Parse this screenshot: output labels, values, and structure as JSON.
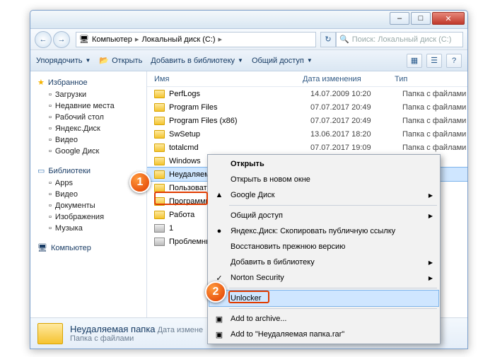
{
  "window_buttons": {
    "min": "–",
    "max": "□",
    "close": "✕"
  },
  "nav": {
    "back": "←",
    "fwd": "→"
  },
  "breadcrumb": {
    "root": "Компьютер",
    "drive": "Локальный диск (C:)"
  },
  "search": {
    "placeholder": "Поиск: Локальный диск (C:)"
  },
  "toolbar": {
    "organize": "Упорядочить",
    "open": "Открыть",
    "addlib": "Добавить в библиотеку",
    "share": "Общий доступ"
  },
  "sidebar": {
    "fav_head": "Избранное",
    "fav": [
      "Загрузки",
      "Недавние места",
      "Рабочий стол",
      "Яндекс.Диск",
      "Видео",
      "Google Диск"
    ],
    "lib_head": "Библиотеки",
    "lib": [
      "Apps",
      "Видео",
      "Документы",
      "Изображения",
      "Музыка"
    ],
    "comp_head": "Компьютер"
  },
  "cols": {
    "name": "Имя",
    "date": "Дата изменения",
    "type": "Тип"
  },
  "rows": [
    {
      "name": "PerfLogs",
      "date": "14.07.2009 10:20",
      "type": "Папка с файлами",
      "k": "folder"
    },
    {
      "name": "Program Files",
      "date": "07.07.2017 20:49",
      "type": "Папка с файлами",
      "k": "folder"
    },
    {
      "name": "Program Files (x86)",
      "date": "07.07.2017 20:49",
      "type": "Папка с файлами",
      "k": "folder"
    },
    {
      "name": "SwSetup",
      "date": "13.06.2017 18:20",
      "type": "Папка с файлами",
      "k": "folder"
    },
    {
      "name": "totalcmd",
      "date": "07.07.2017 19:09",
      "type": "Папка с файлами",
      "k": "folder"
    },
    {
      "name": "Windows",
      "date": "",
      "type": "лами",
      "k": "folder"
    },
    {
      "name": "Неудаляема",
      "date": "",
      "type": "лами",
      "k": "folder",
      "sel": true
    },
    {
      "name": "Пользовател",
      "date": "",
      "type": "лами",
      "k": "folder"
    },
    {
      "name": "Программы",
      "date": "",
      "type": "лами",
      "k": "folder"
    },
    {
      "name": "Работа",
      "date": "",
      "type": "лами",
      "k": "folder"
    },
    {
      "name": "1",
      "date": "",
      "type": "hive",
      "k": "zip"
    },
    {
      "name": "Проблемный",
      "date": "",
      "type": "hive",
      "k": "zip"
    }
  ],
  "ctx": {
    "items": [
      {
        "t": "Открыть",
        "bold": true
      },
      {
        "t": "Открыть в новом окне"
      },
      {
        "t": "Google Диск",
        "arrow": true,
        "ico": "▲"
      },
      {
        "sep": true
      },
      {
        "t": "Общий доступ",
        "arrow": true
      },
      {
        "t": "Яндекс.Диск: Скопировать публичную ссылку",
        "ico": "●"
      },
      {
        "t": "Восстановить прежнюю версию"
      },
      {
        "t": "Добавить в библиотеку",
        "arrow": true
      },
      {
        "t": "Norton Security",
        "arrow": true,
        "ico": "✓"
      },
      {
        "sep": true
      },
      {
        "t": "Unlocker",
        "sel": true,
        "ico": "✱"
      },
      {
        "sep": true
      },
      {
        "t": "Add to archive...",
        "ico": "▣"
      },
      {
        "t": "Add to \"Неудаляемая папка.rar\"",
        "ico": "▣"
      }
    ]
  },
  "details": {
    "title": "Неудаляемая папка",
    "meta": "Дата измене",
    "sub": "Папка с файлами"
  },
  "markers": {
    "m1": "1",
    "m2": "2"
  }
}
